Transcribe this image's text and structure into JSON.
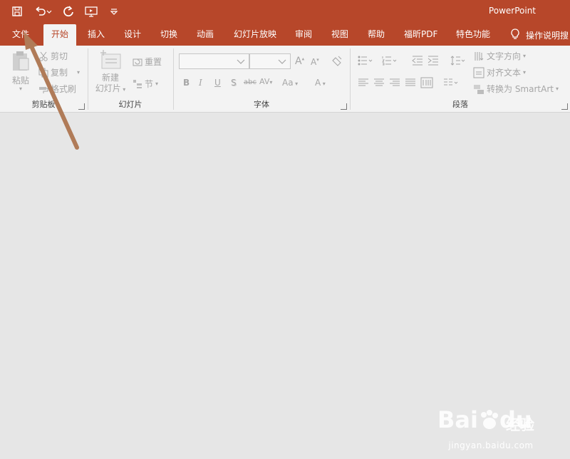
{
  "app_title": "PowerPoint",
  "qat": {
    "save_icon": "save-icon",
    "undo_icon": "undo-icon",
    "redo_icon": "redo-icon",
    "present_icon": "start-slideshow-icon",
    "customize_icon": "customize-qat-icon"
  },
  "tabs": [
    {
      "label": "文件"
    },
    {
      "label": "开始"
    },
    {
      "label": "插入"
    },
    {
      "label": "设计"
    },
    {
      "label": "切换"
    },
    {
      "label": "动画"
    },
    {
      "label": "幻灯片放映"
    },
    {
      "label": "审阅"
    },
    {
      "label": "视图"
    },
    {
      "label": "帮助"
    },
    {
      "label": "福昕PDF"
    },
    {
      "label": "特色功能"
    }
  ],
  "tell_me": {
    "label": "操作说明搜",
    "icon": "lightbulb-icon"
  },
  "ribbon": {
    "clipboard": {
      "label": "剪贴板",
      "paste": "粘贴",
      "cut": "剪切",
      "copy": "复制",
      "format_painter": "格式刷"
    },
    "slides": {
      "label": "幻灯片",
      "new_slide_line1": "新建",
      "new_slide_line2": "幻灯片",
      "reset": "重置",
      "section": "节"
    },
    "font": {
      "label": "字体",
      "bold": "B",
      "italic": "I",
      "underline": "U",
      "shadow": "S",
      "strike": "abc",
      "spacing": "AV",
      "case": "Aa",
      "color": "A",
      "grow": "A",
      "shrink": "A"
    },
    "paragraph": {
      "label": "段落",
      "text_direction": "文字方向",
      "align_text": "对齐文本",
      "smartart": "转换为 SmartArt"
    }
  },
  "watermark": {
    "brand": "Bai",
    "brand2": "du",
    "cn": "经验",
    "url": "jingyan.baidu.com"
  },
  "colors": {
    "accent": "#b7472a",
    "ribbon_bg": "#f3f3f3",
    "workspace_bg": "#e6e6e6",
    "annotation_arrow": "#b07b58"
  }
}
